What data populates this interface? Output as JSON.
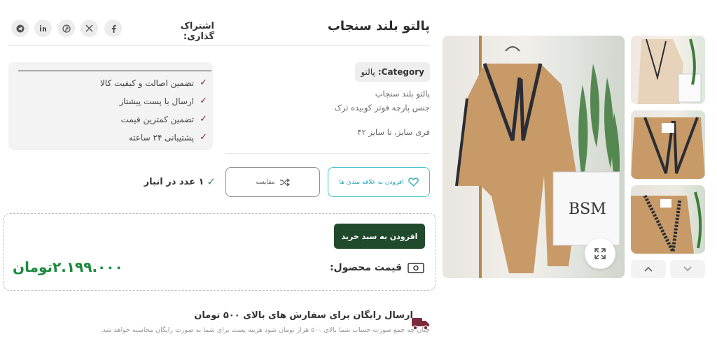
{
  "product": {
    "title": "پالتو بلند سنجاب",
    "category_label": "Category:",
    "category_value": "پالتو",
    "description": [
      "پالتو بلند سنجاب",
      "جنس پارچه فوتر کوبیده ترک",
      "فری سایز، تا سایز ۴۲"
    ]
  },
  "share": {
    "label": "اشتراک گذاری:",
    "icons": [
      "facebook-icon",
      "x-icon",
      "pinterest-icon",
      "linkedin-icon",
      "telegram-icon"
    ]
  },
  "features": [
    "تضمین اصالت و کیفیت کالا",
    "ارسال با پست پیشتاز",
    "تضمین کمترین قیمت",
    "پشتیبانی ۲۴ ساعته"
  ],
  "actions": {
    "wishlist_label": "افزودن به علاقه مندی ها",
    "compare_label": "مقایسه",
    "add_to_cart_label": "افزودن به سبد خرید"
  },
  "stock": {
    "text": "۱ عدد در انبار"
  },
  "price": {
    "label": "قیمت محصول:",
    "value": "۲.۱۹۹.۰۰۰تومان"
  },
  "shipping": {
    "title": "ارسال رایگان برای سفارش های بالای ۵۰۰ تومان",
    "description": "چنان چه جمع صورت حساب شما بالای ۵۰۰ هزار تومان شود هزینه پست برای شما به صورت رایگان محاسبه خواهد شد."
  },
  "colors": {
    "accent_green": "#1f4a2c",
    "price_green": "#1d8a3e",
    "wishlist_teal": "#3fc0c9",
    "check_maroon": "#7a2a3c",
    "coat_camel": "#c79a68"
  }
}
